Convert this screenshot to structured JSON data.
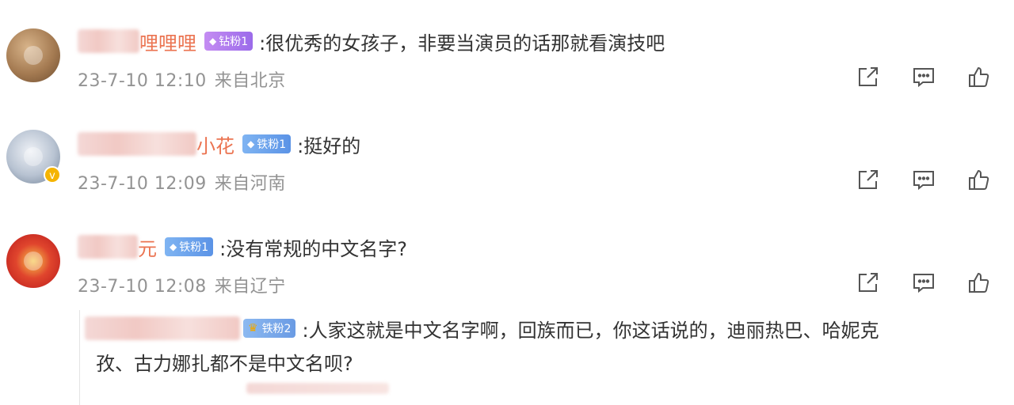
{
  "comments": [
    {
      "name_visible": "哩哩哩",
      "badge": "钻粉1",
      "text": ":很优秀的女孩子，非要当演员的话那就看演技吧",
      "date": "23-7-10 12:10",
      "location": "来自北京"
    },
    {
      "name_visible": "小花",
      "badge": "铁粉1",
      "text": ":挺好的",
      "date": "23-7-10 12:09",
      "location": "来自河南",
      "verified_mark": "v"
    },
    {
      "name_visible": "元",
      "badge": "铁粉1",
      "text": ":没有常规的中文名字?",
      "date": "23-7-10 12:08",
      "location": "来自辽宁"
    }
  ],
  "reply": {
    "badge": "铁粉2",
    "text_line1": ":人家这就是中文名字啊，回族而已，你这话说的，迪丽热巴、哈妮克",
    "text_line2": "孜、古力娜扎都不是中文名呗?"
  },
  "icons": {
    "share": "share-icon",
    "comment": "comment-icon",
    "like": "like-icon"
  },
  "colors": {
    "name": "#eb7350",
    "meta": "#939393",
    "diamond_badge": "#9b6bea",
    "iron_badge": "#5b93e6"
  }
}
